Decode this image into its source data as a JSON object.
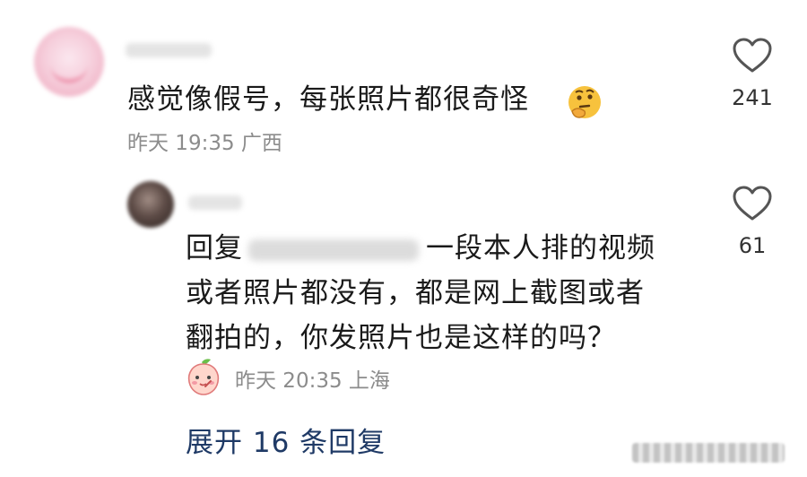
{
  "comment": {
    "text": "感觉像假号，每张照片都很奇怪",
    "emoji": "thinking-face-emoji",
    "time": "昨天 19:35",
    "location": "广西",
    "likes": "241"
  },
  "reply": {
    "prefix": "回复",
    "line1_rest": "一段本人排的视频",
    "line2": "或者照片都没有，都是网上截图或者",
    "line3": "翻拍的，你发照片也是这样的吗？",
    "time": "昨天 20:35",
    "location": "上海",
    "likes": "61",
    "sticker": "peach-character-sticker"
  },
  "expand": {
    "label": "展开 16 条回复"
  },
  "colors": {
    "text": "#1a1a1a",
    "meta": "#8c8c8c",
    "link": "#1f3a66",
    "icon": "#555555"
  }
}
